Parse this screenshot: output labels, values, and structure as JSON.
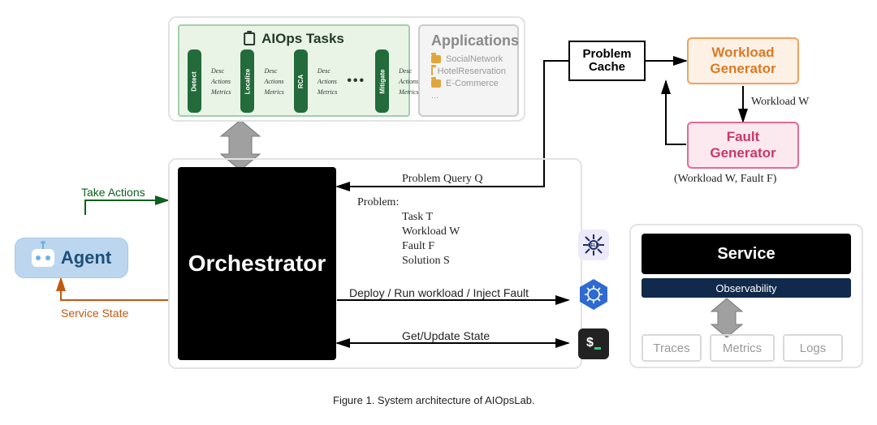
{
  "agent": {
    "label": "Agent"
  },
  "orchestrator": {
    "label": "Orchestrator"
  },
  "service": {
    "label": "Service",
    "observability": "Observability"
  },
  "obs_boxes": {
    "traces": "Traces",
    "metrics": "Metrics",
    "logs": "Logs"
  },
  "problem_cache": "Problem\nCache",
  "workload_gen": "Workload\nGenerator",
  "fault_gen": "Fault\nGenerator",
  "aiops": {
    "title": "AIOps Tasks",
    "tasks": [
      "Detect",
      "Localize",
      "RCA",
      "Mitigate"
    ],
    "desc_lines": [
      "Desc",
      "Actions",
      "Metrics"
    ]
  },
  "applications": {
    "title": "Applications",
    "items": [
      "SocialNetwork",
      "HotelReservation",
      "E-Commerce"
    ],
    "more": "..."
  },
  "edges": {
    "take_actions": "Take Actions",
    "service_state": "Service State",
    "problem_query": "Problem Query Q",
    "problem_block_head": "Problem:",
    "problem_block": [
      "Task T",
      "Workload W",
      "Fault F",
      "Solution S"
    ],
    "deploy": "Deploy / Run workload / Inject Fault",
    "get_state": "Get/Update State",
    "workload_w": "Workload W",
    "wf_pair": "(Workload W, Fault F)"
  },
  "icons": {
    "helm": "HELM",
    "k8s": "kubernetes-icon",
    "terminal": "terminal-icon"
  },
  "caption": "Figure 1. System architecture of AIOpsLab."
}
